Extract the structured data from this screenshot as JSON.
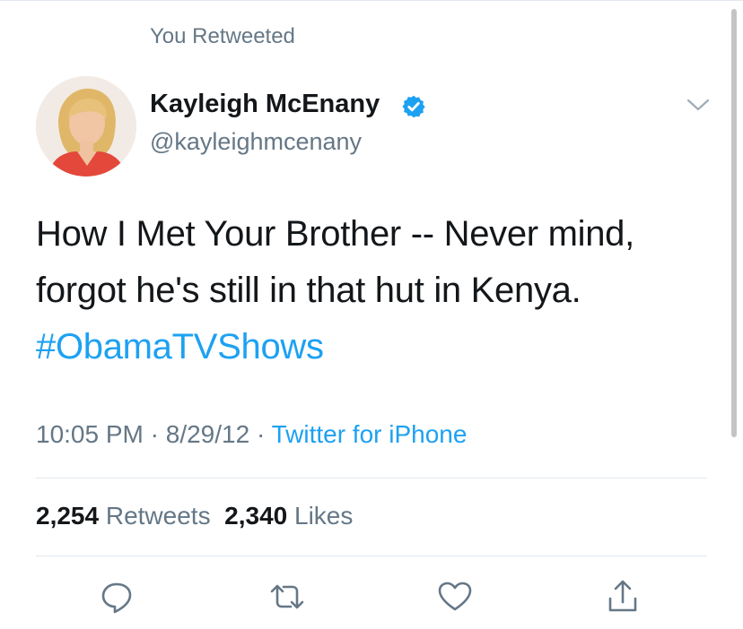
{
  "retweet_label": "You Retweeted",
  "author": {
    "name": "Kayleigh McEnany",
    "handle": "@kayleighmcenany",
    "verified": true
  },
  "tweet": {
    "text_line1": "How I Met Your Brother -- Never mind,",
    "text_line2": "forgot he's still in that hut in Kenya.",
    "hashtag": "#ObamaTVShows"
  },
  "meta": {
    "time": "10:05 PM",
    "separator1": " · ",
    "date": "8/29/12",
    "separator2": " · ",
    "source": "Twitter for iPhone"
  },
  "stats": {
    "retweets_count": "2,254",
    "retweets_label": "Retweets",
    "likes_count": "2,340",
    "likes_label": "Likes"
  },
  "actions": [
    "reply-icon",
    "retweet-icon",
    "like-icon",
    "share-icon"
  ],
  "colors": {
    "accent": "#1da1f2",
    "text": "#14171a",
    "secondary": "#657786",
    "divider": "#e1e8ed"
  }
}
